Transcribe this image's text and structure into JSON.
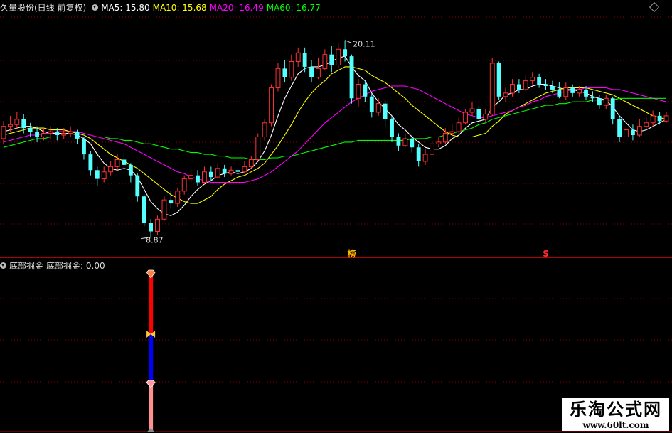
{
  "header": {
    "stock_label": "久量股份(日线 前复权)",
    "ma5": "MA5: 15.80",
    "ma10": "MA10: 15.68",
    "ma20": "MA20: 16.49",
    "ma60": "MA60: 16.77"
  },
  "indicator": {
    "title": "底部掘金",
    "value_label": "底部掘金: 0.00"
  },
  "watermark": {
    "title": "乐淘公式网",
    "url": "www.60lt.com"
  },
  "colors": {
    "up": "#ff3232",
    "down": "#54ffff",
    "ma5": "#ffffff",
    "ma10": "#ffff00",
    "ma20": "#ff00ff",
    "ma60": "#00ff00",
    "grid": "#8b0000",
    "signal_red": "#ff0000",
    "signal_blue": "#0000ff",
    "signal_pink": "#ff9090"
  },
  "chart_data": [
    {
      "type": "candlestick",
      "title": "久量股份(日线 前复权)",
      "ylim": [
        7.8,
        21.6
      ],
      "annotations": [
        {
          "text": "20.11",
          "index": 51,
          "kind": "high"
        },
        {
          "text": "8.87",
          "index": 22,
          "kind": "low"
        },
        {
          "text": "榜",
          "index": 52,
          "kind": "marker"
        },
        {
          "text": "S",
          "index": 81,
          "kind": "marker"
        }
      ],
      "candles": [
        [
          14.5,
          15.2,
          15.5,
          14.2
        ],
        [
          15.2,
          15.3,
          15.8,
          14.9
        ],
        [
          15.3,
          15.6,
          16.0,
          15.1
        ],
        [
          15.6,
          15.1,
          15.9,
          14.8
        ],
        [
          15.1,
          14.9,
          15.4,
          14.6
        ],
        [
          14.9,
          14.6,
          15.2,
          14.3
        ],
        [
          14.6,
          14.8,
          15.1,
          14.4
        ],
        [
          14.8,
          14.9,
          15.2,
          14.5
        ],
        [
          14.9,
          14.7,
          15.1,
          14.4
        ],
        [
          14.7,
          14.8,
          15.1,
          14.5
        ],
        [
          14.8,
          14.9,
          15.2,
          14.6
        ],
        [
          14.9,
          14.5,
          15.0,
          14.2
        ],
        [
          14.5,
          13.6,
          14.6,
          13.3
        ],
        [
          13.6,
          12.7,
          13.8,
          12.4
        ],
        [
          12.7,
          12.2,
          12.9,
          11.8
        ],
        [
          12.2,
          12.6,
          12.9,
          12.0
        ],
        [
          12.6,
          12.9,
          13.2,
          12.4
        ],
        [
          12.9,
          13.3,
          13.6,
          12.7
        ],
        [
          13.3,
          13.0,
          13.7,
          12.8
        ],
        [
          13.0,
          12.4,
          13.1,
          12.0
        ],
        [
          12.4,
          11.2,
          12.5,
          10.9
        ],
        [
          11.2,
          9.7,
          11.3,
          9.5
        ],
        [
          9.7,
          9.2,
          9.9,
          8.87
        ],
        [
          9.2,
          9.9,
          10.1,
          9.0
        ],
        [
          9.9,
          11.0,
          11.2,
          9.8
        ],
        [
          11.0,
          10.8,
          11.5,
          10.5
        ],
        [
          10.8,
          11.5,
          11.7,
          10.6
        ],
        [
          11.5,
          12.2,
          12.4,
          11.3
        ],
        [
          12.2,
          12.4,
          12.8,
          12.0
        ],
        [
          12.4,
          12.0,
          12.7,
          11.8
        ],
        [
          12.0,
          12.6,
          12.9,
          11.9
        ],
        [
          12.6,
          12.3,
          12.9,
          12.1
        ],
        [
          12.3,
          12.8,
          13.1,
          12.2
        ],
        [
          12.8,
          12.5,
          13.0,
          12.3
        ],
        [
          12.5,
          12.7,
          12.9,
          12.4
        ],
        [
          12.7,
          12.6,
          12.9,
          12.4
        ],
        [
          12.6,
          12.9,
          13.2,
          12.5
        ],
        [
          12.9,
          13.3,
          13.5,
          12.8
        ],
        [
          13.3,
          14.6,
          14.8,
          13.2
        ],
        [
          14.6,
          15.4,
          15.6,
          14.4
        ],
        [
          15.4,
          17.4,
          17.6,
          15.2
        ],
        [
          17.4,
          18.5,
          18.8,
          17.2
        ],
        [
          18.5,
          18.0,
          19.0,
          17.7
        ],
        [
          18.0,
          18.9,
          19.3,
          17.8
        ],
        [
          18.9,
          19.4,
          19.7,
          18.6
        ],
        [
          19.4,
          18.6,
          19.7,
          18.3
        ],
        [
          18.6,
          18.0,
          19.0,
          17.7
        ],
        [
          18.0,
          18.5,
          19.1,
          17.9
        ],
        [
          18.5,
          19.3,
          19.6,
          18.4
        ],
        [
          19.3,
          18.7,
          19.8,
          18.3
        ],
        [
          18.7,
          19.6,
          20.0,
          18.5
        ],
        [
          19.6,
          19.2,
          20.11,
          18.9
        ],
        [
          19.2,
          16.8,
          19.3,
          16.5
        ],
        [
          16.8,
          17.6,
          17.9,
          16.3
        ],
        [
          17.6,
          16.9,
          17.8,
          16.6
        ],
        [
          16.9,
          16.0,
          17.1,
          15.7
        ],
        [
          16.0,
          16.5,
          16.8,
          15.8
        ],
        [
          16.5,
          15.6,
          16.7,
          15.2
        ],
        [
          15.6,
          14.6,
          15.8,
          14.3
        ],
        [
          14.6,
          14.1,
          14.8,
          13.8
        ],
        [
          14.1,
          14.5,
          14.8,
          14.0
        ],
        [
          14.5,
          14.0,
          14.7,
          13.7
        ],
        [
          14.0,
          13.2,
          14.2,
          12.9
        ],
        [
          13.2,
          13.6,
          13.9,
          13.0
        ],
        [
          13.6,
          14.2,
          14.5,
          13.5
        ],
        [
          14.2,
          14.3,
          14.6,
          14.0
        ],
        [
          14.3,
          14.8,
          15.1,
          14.2
        ],
        [
          14.8,
          14.9,
          15.3,
          14.6
        ],
        [
          14.9,
          15.4,
          15.7,
          14.8
        ],
        [
          15.4,
          16.0,
          16.2,
          15.3
        ],
        [
          16.0,
          16.2,
          16.6,
          15.8
        ],
        [
          16.2,
          15.6,
          16.4,
          15.3
        ],
        [
          15.6,
          15.9,
          16.2,
          15.4
        ],
        [
          15.9,
          18.8,
          19.1,
          15.8
        ],
        [
          18.8,
          16.9,
          18.9,
          16.7
        ],
        [
          16.9,
          17.1,
          17.4,
          16.6
        ],
        [
          17.1,
          17.6,
          17.9,
          16.9
        ],
        [
          17.6,
          17.3,
          17.9,
          17.1
        ],
        [
          17.3,
          17.8,
          18.1,
          17.2
        ],
        [
          17.8,
          18.0,
          18.3,
          17.6
        ],
        [
          18.0,
          17.6,
          18.2,
          17.4
        ],
        [
          17.6,
          17.5,
          17.9,
          17.3
        ],
        [
          17.5,
          17.3,
          17.8,
          17.1
        ],
        [
          17.3,
          16.9,
          17.7,
          16.8
        ],
        [
          16.9,
          17.4,
          17.7,
          16.7
        ],
        [
          17.4,
          17.1,
          17.6,
          16.9
        ],
        [
          17.1,
          17.3,
          17.5,
          16.9
        ],
        [
          17.3,
          16.9,
          17.5,
          16.7
        ],
        [
          16.9,
          16.8,
          17.2,
          16.6
        ],
        [
          16.8,
          16.4,
          17.0,
          16.2
        ],
        [
          16.4,
          16.8,
          17.0,
          16.2
        ],
        [
          16.8,
          15.6,
          16.9,
          15.3
        ],
        [
          15.6,
          14.6,
          15.8,
          14.3
        ],
        [
          14.6,
          15.0,
          15.3,
          14.4
        ],
        [
          15.0,
          14.7,
          15.3,
          14.4
        ],
        [
          14.7,
          15.2,
          15.6,
          14.6
        ],
        [
          15.2,
          15.4,
          15.7,
          15.0
        ],
        [
          15.4,
          15.8,
          16.1,
          15.2
        ],
        [
          15.8,
          15.5,
          16.0,
          15.3
        ],
        [
          15.5,
          15.8,
          16.0,
          15.4
        ]
      ],
      "series": [
        {
          "name": "MA5",
          "values": [
            14.9,
            15.0,
            15.1,
            15.2,
            15.2,
            15.1,
            14.9,
            14.8,
            14.8,
            14.8,
            14.8,
            14.7,
            14.5,
            14.2,
            13.6,
            13.1,
            12.8,
            12.7,
            12.8,
            12.7,
            12.3,
            11.6,
            10.9,
            10.5,
            10.2,
            10.1,
            10.3,
            10.7,
            11.2,
            11.6,
            11.9,
            12.1,
            12.4,
            12.5,
            12.6,
            12.5,
            12.6,
            12.8,
            13.2,
            13.8,
            14.7,
            15.8,
            16.8,
            17.5,
            18.2,
            18.5,
            18.6,
            18.6,
            18.7,
            18.9,
            19.1,
            19.2,
            18.6,
            18.1,
            17.8,
            17.1,
            16.6,
            16.2,
            15.8,
            15.3,
            15.0,
            14.6,
            14.3,
            14.0,
            13.9,
            13.9,
            14.1,
            14.5,
            14.7,
            15.1,
            15.4,
            15.5,
            15.6,
            16.3,
            16.6,
            17.0,
            17.1,
            17.3,
            17.3,
            17.5,
            17.6,
            17.6,
            17.5,
            17.4,
            17.3,
            17.3,
            17.2,
            17.1,
            16.9,
            16.8,
            16.7,
            16.3,
            15.8,
            15.4,
            15.0,
            14.9,
            15.0,
            15.2,
            15.4,
            15.6
          ]
        },
        {
          "name": "MA10",
          "values": [
            14.7,
            14.8,
            14.9,
            15.0,
            15.1,
            15.1,
            15.1,
            15.0,
            15.0,
            15.0,
            14.9,
            14.8,
            14.7,
            14.5,
            14.2,
            13.9,
            13.6,
            13.4,
            13.2,
            13.0,
            12.8,
            12.5,
            12.2,
            11.9,
            11.6,
            11.3,
            11.1,
            10.9,
            10.8,
            10.8,
            11.0,
            11.2,
            11.6,
            11.9,
            12.1,
            12.3,
            12.4,
            12.6,
            12.8,
            13.1,
            13.6,
            14.1,
            14.7,
            15.3,
            16.0,
            16.6,
            17.1,
            17.5,
            17.8,
            18.2,
            18.4,
            18.6,
            18.6,
            18.5,
            18.4,
            18.1,
            17.9,
            17.7,
            17.4,
            17.1,
            16.8,
            16.4,
            16.1,
            15.8,
            15.5,
            15.2,
            14.9,
            14.7,
            14.6,
            14.6,
            14.6,
            14.7,
            14.8,
            15.2,
            15.5,
            15.9,
            16.1,
            16.3,
            16.5,
            16.7,
            16.9,
            17.1,
            17.2,
            17.3,
            17.4,
            17.4,
            17.4,
            17.4,
            17.3,
            17.2,
            17.1,
            17.0,
            16.8,
            16.6,
            16.4,
            16.2,
            16.0,
            15.8,
            15.7,
            15.6
          ]
        },
        {
          "name": "MA20",
          "values": [
            14.3,
            14.4,
            14.5,
            14.6,
            14.7,
            14.7,
            14.8,
            14.8,
            14.9,
            14.9,
            14.9,
            14.9,
            14.8,
            14.7,
            14.6,
            14.5,
            14.4,
            14.3,
            14.2,
            14.0,
            13.8,
            13.6,
            13.4,
            13.2,
            13.0,
            12.8,
            12.6,
            12.5,
            12.3,
            12.2,
            12.1,
            12.0,
            12.0,
            12.0,
            12.0,
            12.0,
            12.0,
            12.1,
            12.2,
            12.4,
            12.6,
            12.9,
            13.2,
            13.5,
            13.8,
            14.2,
            14.6,
            15.0,
            15.4,
            15.7,
            16.0,
            16.3,
            16.6,
            16.8,
            17.0,
            17.2,
            17.3,
            17.4,
            17.5,
            17.5,
            17.5,
            17.4,
            17.3,
            17.1,
            16.9,
            16.7,
            16.5,
            16.3,
            16.1,
            15.9,
            15.8,
            15.7,
            15.7,
            15.8,
            15.9,
            16.0,
            16.1,
            16.3,
            16.4,
            16.6,
            16.7,
            16.9,
            17.0,
            17.1,
            17.2,
            17.3,
            17.3,
            17.4,
            17.4,
            17.4,
            17.4,
            17.3,
            17.3,
            17.2,
            17.1,
            17.0,
            16.9,
            16.8,
            16.7,
            16.6
          ]
        },
        {
          "name": "MA60",
          "values": [
            14.0,
            14.1,
            14.2,
            14.3,
            14.4,
            14.5,
            14.5,
            14.6,
            14.6,
            14.6,
            14.6,
            14.6,
            14.6,
            14.6,
            14.6,
            14.6,
            14.5,
            14.5,
            14.4,
            14.4,
            14.3,
            14.2,
            14.2,
            14.1,
            14.0,
            13.9,
            13.9,
            13.8,
            13.7,
            13.7,
            13.6,
            13.6,
            13.5,
            13.5,
            13.4,
            13.4,
            13.4,
            13.3,
            13.3,
            13.3,
            13.4,
            13.4,
            13.5,
            13.5,
            13.6,
            13.7,
            13.8,
            13.9,
            14.0,
            14.1,
            14.2,
            14.3,
            14.3,
            14.4,
            14.4,
            14.4,
            14.4,
            14.4,
            14.4,
            14.4,
            14.4,
            14.5,
            14.5,
            14.5,
            14.6,
            14.6,
            14.7,
            14.8,
            14.9,
            15.0,
            15.1,
            15.3,
            15.4,
            15.6,
            15.7,
            15.8,
            15.9,
            16.0,
            16.1,
            16.2,
            16.3,
            16.4,
            16.4,
            16.5,
            16.5,
            16.6,
            16.6,
            16.6,
            16.7,
            16.7,
            16.7,
            16.7,
            16.8,
            16.8,
            16.8,
            16.8,
            16.8,
            16.8,
            16.8,
            16.8
          ]
        }
      ]
    },
    {
      "type": "bar",
      "title": "底部掘金",
      "signal_index": 22,
      "segments": [
        {
          "name": "red",
          "from": 1.0,
          "to": 0.62
        },
        {
          "name": "blue",
          "from": 0.62,
          "to": 0.3
        },
        {
          "name": "pink",
          "from": 0.3,
          "to": 0.0
        }
      ]
    }
  ]
}
